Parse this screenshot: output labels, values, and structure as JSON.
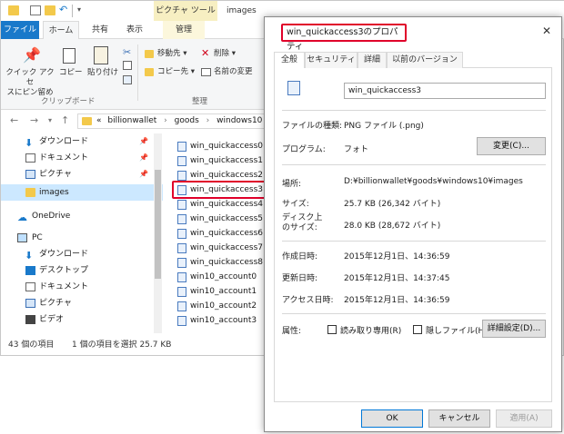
{
  "explorer": {
    "qat_undo_icon": "undo-icon",
    "context_tab": "ピクチャ ツール",
    "window_title": "images",
    "controls": {
      "minimize": "—",
      "maximize": "☐",
      "close": "✕"
    },
    "tabs": [
      "ファイル",
      "ホーム",
      "共有",
      "表示",
      "管理"
    ],
    "ribbon": {
      "pin_label_1": "クイック アクセ",
      "pin_label_2": "スにピン留め",
      "copy": "コピー",
      "paste_1": "貼り付け",
      "paste_2": "",
      "move_to": "移動先 ▾",
      "copy_to": "コピー先 ▾",
      "delete": "削除 ▾",
      "rename": "名前の変更",
      "group_clipboard": "クリップボード",
      "group_organize": "整理"
    },
    "breadcrumb": {
      "prefix": "«",
      "parts": [
        "billionwallet",
        "goods",
        "windows10"
      ],
      "sep": "›"
    },
    "nav": [
      {
        "label": "ダウンロード",
        "icon": "download-icon",
        "pinned": true
      },
      {
        "label": "ドキュメント",
        "icon": "document-icon",
        "pinned": true
      },
      {
        "label": "ピクチャ",
        "icon": "picture-icon",
        "pinned": true
      },
      {
        "label": "images",
        "icon": "folder-icon",
        "pinned": false,
        "selected": true
      },
      {
        "label": "OneDrive",
        "icon": "cloud-icon",
        "pinned": false
      },
      {
        "label": "PC",
        "icon": "pc-icon",
        "pinned": false
      },
      {
        "label": "ダウンロード",
        "icon": "download-icon",
        "pinned": false
      },
      {
        "label": "デスクトップ",
        "icon": "desktop-icon",
        "pinned": false
      },
      {
        "label": "ドキュメント",
        "icon": "document-icon",
        "pinned": false
      },
      {
        "label": "ピクチャ",
        "icon": "picture-icon",
        "pinned": false
      },
      {
        "label": "ビデオ",
        "icon": "video-icon",
        "pinned": false
      }
    ],
    "pin_glyph": "📌",
    "files": [
      "win_quickaccess0",
      "win_quickaccess1",
      "win_quickaccess2",
      "win_quickaccess3",
      "win_quickaccess4",
      "win_quickaccess5",
      "win_quickaccess6",
      "win_quickaccess7",
      "win_quickaccess8",
      "win10_account0",
      "win10_account1",
      "win10_account2",
      "win10_account3"
    ],
    "selected_file_index": 3,
    "status": {
      "count": "43 個の項目",
      "selection": "1 個の項目を選択 25.7 KB"
    }
  },
  "dialog": {
    "title": "win_quickaccess3のプロパティ",
    "close": "✕",
    "tabs": [
      "全般",
      "セキュリティ",
      "詳細",
      "以前のバージョン"
    ],
    "filename": "win_quickaccess3",
    "rows": {
      "type_label": "ファイルの種類:",
      "type_value": "PNG ファイル (.png)",
      "program_label": "プログラム:",
      "program_value": "フォト",
      "change_button": "変更(C)...",
      "location_label": "場所:",
      "location_value": "D:¥billionwallet¥goods¥windows10¥images",
      "size_label": "サイズ:",
      "size_value": "25.7 KB (26,342 バイト)",
      "disk_label_1": "ディスク上",
      "disk_label_2": "のサイズ:",
      "disk_value": "28.0 KB (28,672 バイト)",
      "created_label": "作成日時:",
      "created_value": "2015年12月1日、14:36:59",
      "modified_label": "更新日時:",
      "modified_value": "2015年12月1日、14:37:45",
      "accessed_label": "アクセス日時:",
      "accessed_value": "2015年12月1日、14:36:59",
      "attr_label": "属性:",
      "readonly": "読み取り専用(R)",
      "hidden": "隠しファイル(H)",
      "advanced_button": "詳細設定(D)..."
    },
    "buttons": {
      "ok": "OK",
      "cancel": "キャンセル",
      "apply": "適用(A)"
    }
  },
  "colors": {
    "accent": "#1979ca",
    "highlight": "#e0002a",
    "selection": "#cce8ff",
    "context_tab": "#f7efc2"
  }
}
